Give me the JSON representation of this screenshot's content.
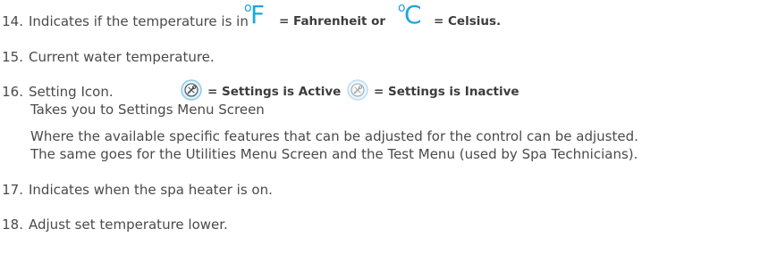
{
  "items": [
    {
      "number": "14.",
      "text_before": "Indicates if the temperature is in",
      "symbol_f": "F",
      "label_f": "= Fahrenheit or",
      "symbol_c": "C",
      "label_c": "= Celsius.",
      "degree_mark": "o",
      "symbol_color": "#1fa5dc"
    },
    {
      "number": "15.",
      "text": "Current water temperature."
    },
    {
      "number": "16.",
      "text_before": "Setting Icon.",
      "active_label": "= Settings is Active",
      "inactive_label": "= Settings is Inactive",
      "active_icon": "settings-active-icon",
      "inactive_icon": "settings-inactive-icon",
      "line2": "Takes you to Settings Menu Screen",
      "line3": "Where the available specific features that can be adjusted for the control can be adjusted.",
      "line4": "The same goes for the Utilities Menu Screen and the Test Menu (used by Spa Technicians)."
    },
    {
      "number": "17.",
      "text": "Indicates when the spa heater is on."
    },
    {
      "number": "18.",
      "text": "Adjust set temperature lower."
    }
  ],
  "colors": {
    "text": "#4a4a4a",
    "accent": "#1fa5dc",
    "icon_active_ring": "#9ad2ef",
    "icon_inactive_ring": "#c9e6f5"
  }
}
